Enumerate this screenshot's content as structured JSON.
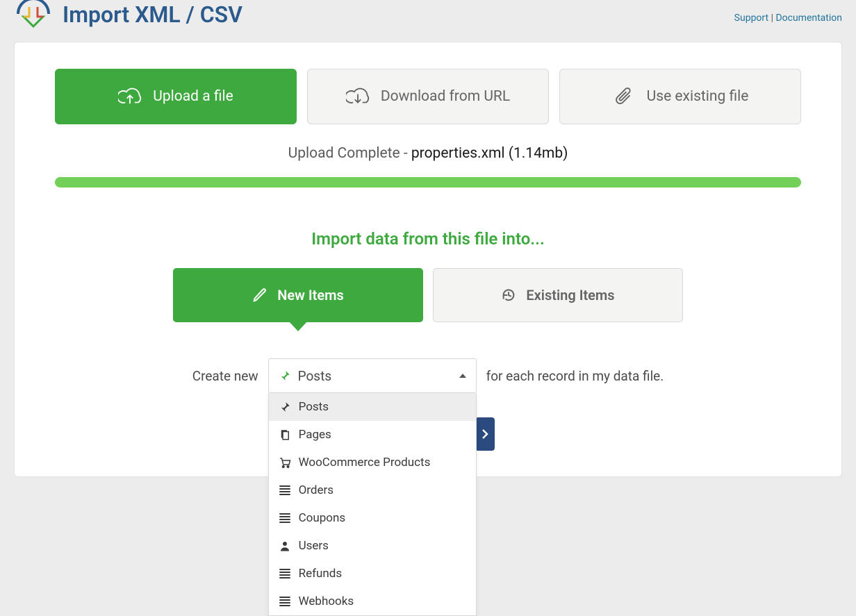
{
  "header": {
    "title": "Import XML / CSV",
    "links": {
      "support": "Support",
      "documentation": "Documentation"
    }
  },
  "source_tabs": {
    "upload": "Upload a file",
    "download": "Download from URL",
    "existing": "Use existing file"
  },
  "upload": {
    "status_prefix": "Upload Complete - ",
    "filename": "properties.xml",
    "size": "(1.14mb)"
  },
  "import_into_heading": "Import data from this file into...",
  "mode_tabs": {
    "new": "New Items",
    "existing": "Existing Items"
  },
  "create_row": {
    "prefix": "Create new",
    "suffix": "for each record in my data file."
  },
  "select": {
    "selected": "Posts",
    "options": [
      {
        "label": "Posts",
        "icon": "pin"
      },
      {
        "label": "Pages",
        "icon": "pages"
      },
      {
        "label": "WooCommerce Products",
        "icon": "cart"
      },
      {
        "label": "Orders",
        "icon": "list"
      },
      {
        "label": "Coupons",
        "icon": "list"
      },
      {
        "label": "Users",
        "icon": "user"
      },
      {
        "label": "Refunds",
        "icon": "list"
      },
      {
        "label": "Webhooks",
        "icon": "list"
      }
    ]
  }
}
